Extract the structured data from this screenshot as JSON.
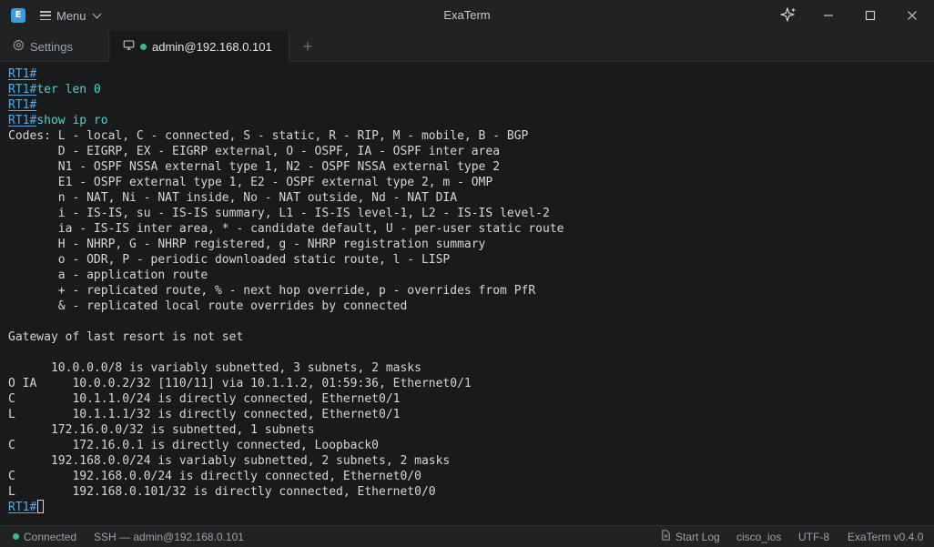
{
  "app": {
    "logo_letter": "E",
    "menu_label": "Menu",
    "title": "ExaTerm"
  },
  "tabs": {
    "settings_label": "Settings",
    "session_label": "admin@192.168.0.101"
  },
  "terminal": {
    "prompt": "RT1#",
    "lines": [
      {
        "prompt": "RT1#",
        "cmd": "",
        "text": ""
      },
      {
        "prompt": "RT1#",
        "cmd": "ter len 0",
        "text": ""
      },
      {
        "prompt": "RT1#",
        "cmd": "",
        "text": ""
      },
      {
        "prompt": "RT1#",
        "cmd": "show ip ro",
        "text": ""
      },
      {
        "prompt": "",
        "cmd": "",
        "text": "Codes: L - local, C - connected, S - static, R - RIP, M - mobile, B - BGP"
      },
      {
        "prompt": "",
        "cmd": "",
        "text": "       D - EIGRP, EX - EIGRP external, O - OSPF, IA - OSPF inter area"
      },
      {
        "prompt": "",
        "cmd": "",
        "text": "       N1 - OSPF NSSA external type 1, N2 - OSPF NSSA external type 2"
      },
      {
        "prompt": "",
        "cmd": "",
        "text": "       E1 - OSPF external type 1, E2 - OSPF external type 2, m - OMP"
      },
      {
        "prompt": "",
        "cmd": "",
        "text": "       n - NAT, Ni - NAT inside, No - NAT outside, Nd - NAT DIA"
      },
      {
        "prompt": "",
        "cmd": "",
        "text": "       i - IS-IS, su - IS-IS summary, L1 - IS-IS level-1, L2 - IS-IS level-2"
      },
      {
        "prompt": "",
        "cmd": "",
        "text": "       ia - IS-IS inter area, * - candidate default, U - per-user static route"
      },
      {
        "prompt": "",
        "cmd": "",
        "text": "       H - NHRP, G - NHRP registered, g - NHRP registration summary"
      },
      {
        "prompt": "",
        "cmd": "",
        "text": "       o - ODR, P - periodic downloaded static route, l - LISP"
      },
      {
        "prompt": "",
        "cmd": "",
        "text": "       a - application route"
      },
      {
        "prompt": "",
        "cmd": "",
        "text": "       + - replicated route, % - next hop override, p - overrides from PfR"
      },
      {
        "prompt": "",
        "cmd": "",
        "text": "       & - replicated local route overrides by connected"
      },
      {
        "prompt": "",
        "cmd": "",
        "text": ""
      },
      {
        "prompt": "",
        "cmd": "",
        "text": "Gateway of last resort is not set"
      },
      {
        "prompt": "",
        "cmd": "",
        "text": ""
      },
      {
        "prompt": "",
        "cmd": "",
        "text": "      10.0.0.0/8 is variably subnetted, 3 subnets, 2 masks"
      },
      {
        "prompt": "",
        "cmd": "",
        "text": "O IA     10.0.0.2/32 [110/11] via 10.1.1.2, 01:59:36, Ethernet0/1"
      },
      {
        "prompt": "",
        "cmd": "",
        "text": "C        10.1.1.0/24 is directly connected, Ethernet0/1"
      },
      {
        "prompt": "",
        "cmd": "",
        "text": "L        10.1.1.1/32 is directly connected, Ethernet0/1"
      },
      {
        "prompt": "",
        "cmd": "",
        "text": "      172.16.0.0/32 is subnetted, 1 subnets"
      },
      {
        "prompt": "",
        "cmd": "",
        "text": "C        172.16.0.1 is directly connected, Loopback0"
      },
      {
        "prompt": "",
        "cmd": "",
        "text": "      192.168.0.0/24 is variably subnetted, 2 subnets, 2 masks"
      },
      {
        "prompt": "",
        "cmd": "",
        "text": "C        192.168.0.0/24 is directly connected, Ethernet0/0"
      },
      {
        "prompt": "",
        "cmd": "",
        "text": "L        192.168.0.101/32 is directly connected, Ethernet0/0"
      },
      {
        "prompt": "RT1#",
        "cmd": "",
        "text": "",
        "cursor": true
      }
    ]
  },
  "statusbar": {
    "connection_status": "Connected",
    "session_info": "SSH — admin@192.168.0.101",
    "start_log_label": "Start Log",
    "device_type": "cisco_ios",
    "encoding": "UTF-8",
    "version": "ExaTerm v0.4.0"
  },
  "colors": {
    "accent": "#3d9bd8",
    "connected": "#3fb68b",
    "prompt": "#58a9e6",
    "command": "#4fd6c6",
    "terminal_bg": "#181a1c"
  }
}
